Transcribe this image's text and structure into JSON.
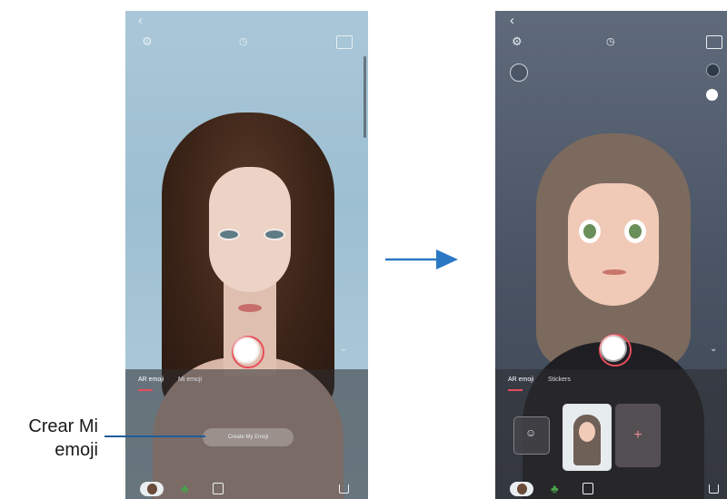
{
  "left_screen": {
    "tabs": [
      "AR emoji",
      "Mi emoji"
    ],
    "create_button_label": "Create My Emoji"
  },
  "right_screen": {
    "tabs": [
      "AR emoji",
      "Stickers"
    ],
    "add_symbol": "+"
  },
  "top_icons": {
    "back": "‹",
    "settings": "⚙",
    "timer_off": "OFF",
    "ratio": "Full"
  },
  "callout": {
    "line1": "Crear Mi",
    "line2": "emoji"
  },
  "colors": {
    "accent": "#e74c5b",
    "arrow": "#2a78c4",
    "callout_line": "#1f5c99"
  },
  "icons": [
    "back-arrow-icon",
    "gear-icon",
    "timer-off-icon",
    "aspect-ratio-icon",
    "chevron-down-icon",
    "share-icon",
    "clover-icon",
    "sticker-icon",
    "plus-icon",
    "person-icon"
  ]
}
